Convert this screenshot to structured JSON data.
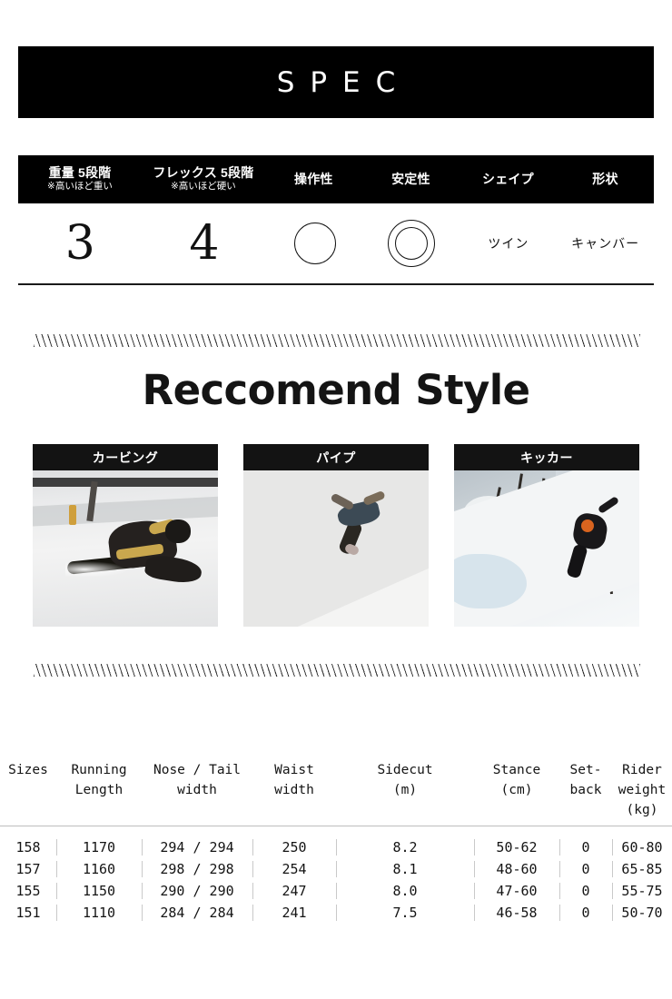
{
  "spec": {
    "banner_title": "SPEC",
    "columns": [
      {
        "title": "重量 5段階",
        "note": "※高いほど重い",
        "value_type": "number",
        "value": "3"
      },
      {
        "title": "フレックス 5段階",
        "note": "※高いほど硬い",
        "value_type": "number",
        "value": "4"
      },
      {
        "title": "操作性",
        "note": "",
        "value_type": "circle",
        "value": "○"
      },
      {
        "title": "安定性",
        "note": "",
        "value_type": "double-circle",
        "value": "◎"
      },
      {
        "title": "シェイプ",
        "note": "",
        "value_type": "text",
        "value": "ツイン"
      },
      {
        "title": "形状",
        "note": "",
        "value_type": "text",
        "value": "キャンバー"
      }
    ]
  },
  "recommend": {
    "title": "Reccomend Style",
    "cards": [
      {
        "caption": "カービング",
        "photo": "snowboarder-carving-turn-on-snow"
      },
      {
        "caption": "パイプ",
        "photo": "snowboarder-airborne-over-halfpipe"
      },
      {
        "caption": "キッカー",
        "photo": "snowboarder-jumping-kicker-near-trees"
      }
    ]
  },
  "size_table": {
    "headers": [
      {
        "line1": "Sizes",
        "line2": ""
      },
      {
        "line1": "Running",
        "line2": "Length"
      },
      {
        "line1": "Nose / Tail",
        "line2": "width"
      },
      {
        "line1": "Waist",
        "line2": "width"
      },
      {
        "line1": "Sidecut",
        "line2": "(m)"
      },
      {
        "line1": "Stance",
        "line2": "(cm)"
      },
      {
        "line1": "Set-",
        "line2": "back"
      },
      {
        "line1": "Rider weight",
        "line2": "(kg)"
      }
    ],
    "rows": [
      {
        "size": "158",
        "running_length": "1170",
        "nose_tail_width": "294 / 294",
        "waist_width": "250",
        "sidecut": "8.2",
        "stance": "50-62",
        "setback": "0",
        "rider_weight": "60-80"
      },
      {
        "size": "157",
        "running_length": "1160",
        "nose_tail_width": "298 / 298",
        "waist_width": "254",
        "sidecut": "8.1",
        "stance": "48-60",
        "setback": "0",
        "rider_weight": "65-85"
      },
      {
        "size": "155",
        "running_length": "1150",
        "nose_tail_width": "290 / 290",
        "waist_width": "247",
        "sidecut": "8.0",
        "stance": "47-60",
        "setback": "0",
        "rider_weight": "55-75"
      },
      {
        "size": "151",
        "running_length": "1110",
        "nose_tail_width": "284 / 284",
        "waist_width": "241",
        "sidecut": "7.5",
        "stance": "46-58",
        "setback": "0",
        "rider_weight": "50-70"
      }
    ]
  },
  "colors": {
    "banner_bg": "#000000",
    "banner_text": "#ffffff",
    "page_bg": "#ffffff",
    "text": "#141414",
    "divider": "#c9c9c9"
  }
}
